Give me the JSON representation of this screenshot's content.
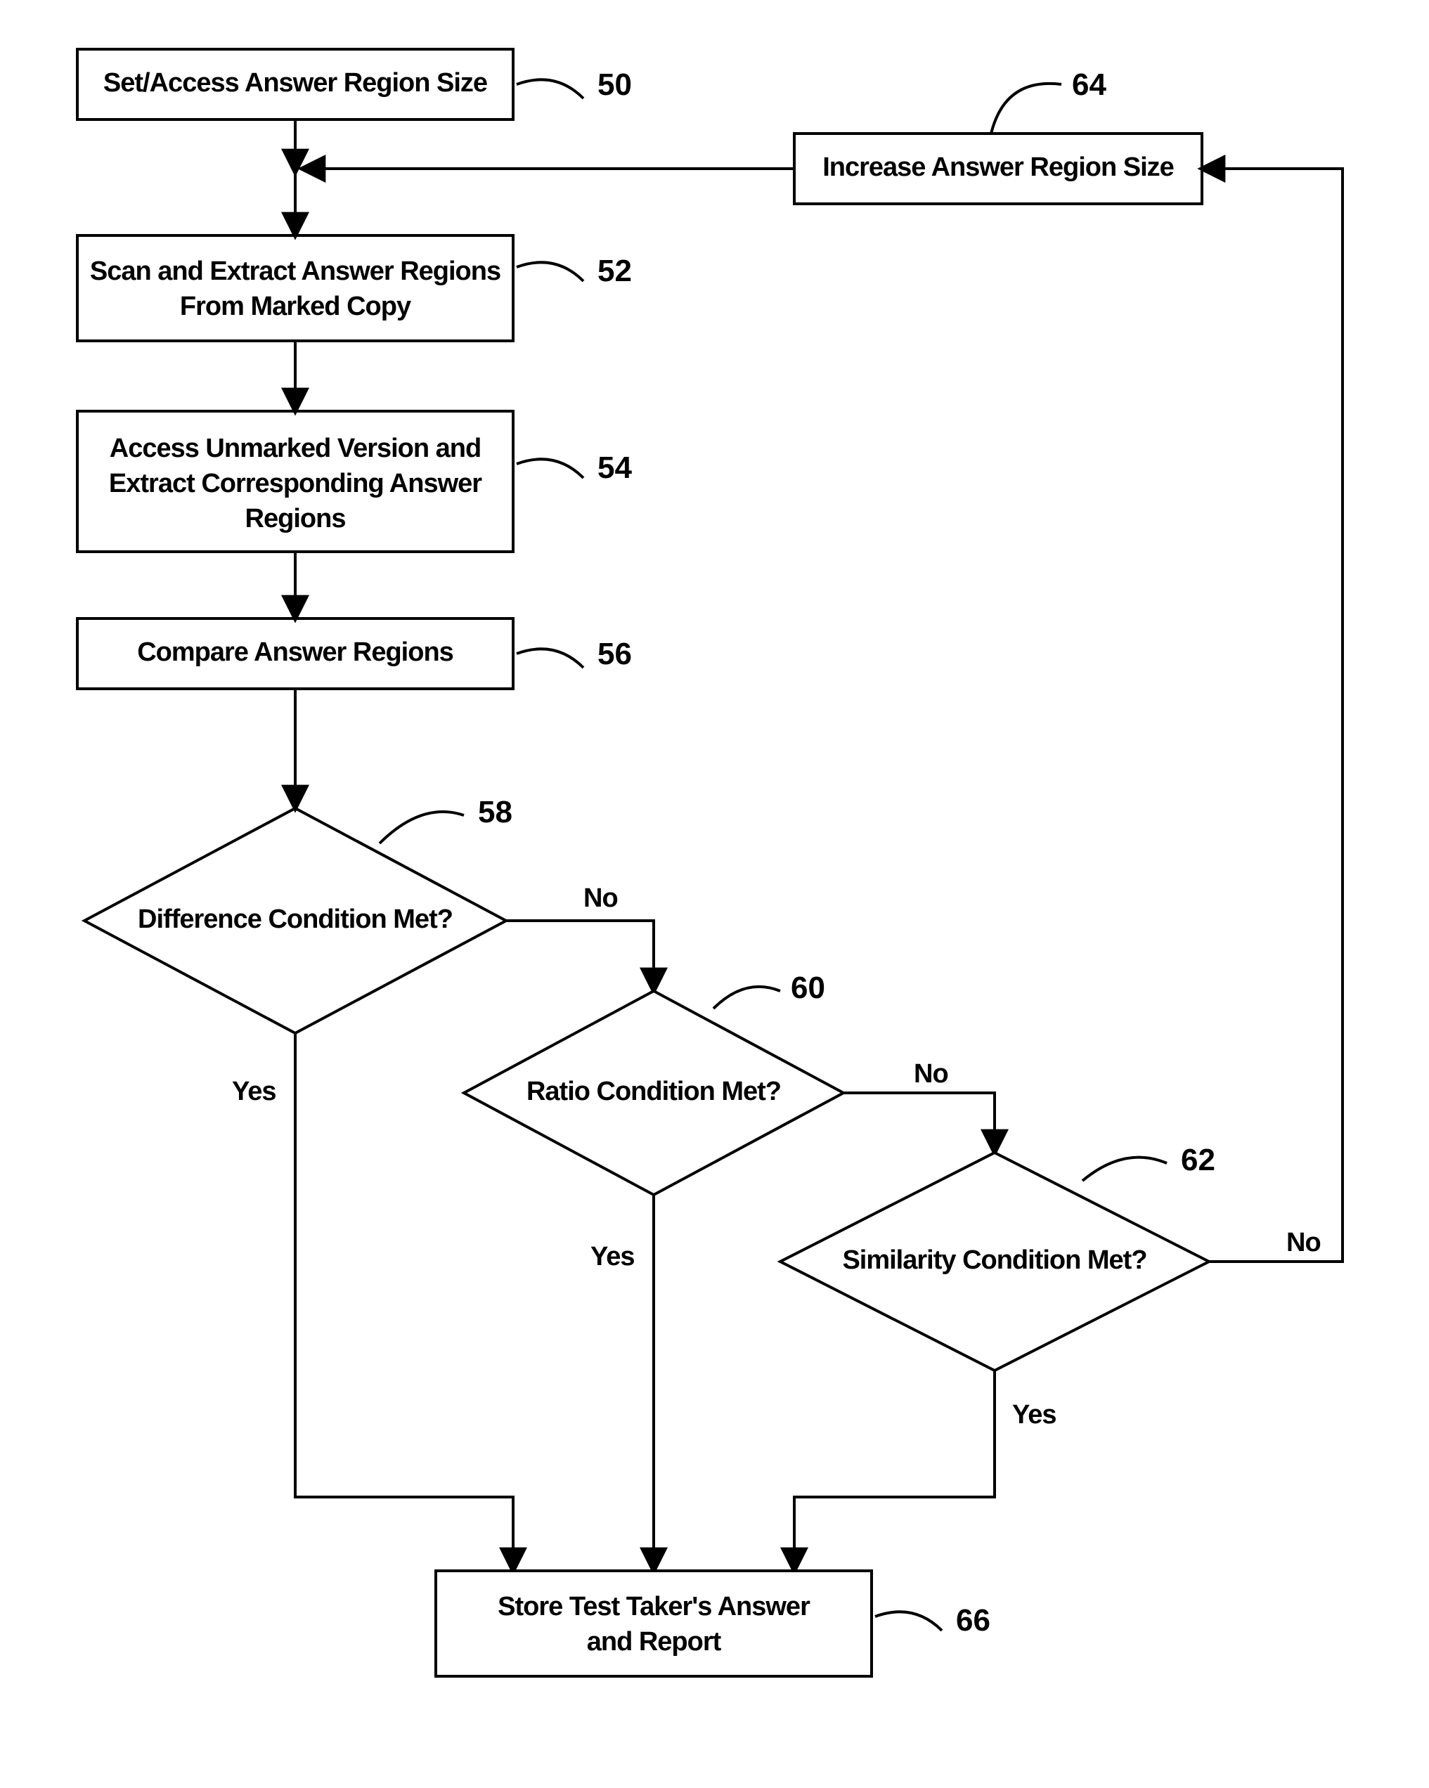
{
  "nodes": {
    "n50": {
      "text": [
        "Set/Access Answer Region Size"
      ],
      "ref": "50"
    },
    "n52": {
      "text": [
        "Scan and Extract Answer Regions",
        "From Marked Copy"
      ],
      "ref": "52"
    },
    "n54": {
      "text": [
        "Access Unmarked Version and",
        "Extract Corresponding Answer",
        "Regions"
      ],
      "ref": "54"
    },
    "n56": {
      "text": [
        "Compare Answer Regions"
      ],
      "ref": "56"
    },
    "n58": {
      "text": [
        "Difference Condition Met?"
      ],
      "ref": "58"
    },
    "n60": {
      "text": [
        "Ratio Condition Met?"
      ],
      "ref": "60"
    },
    "n62": {
      "text": [
        "Similarity Condition Met?"
      ],
      "ref": "62"
    },
    "n64": {
      "text": [
        "Increase Answer Region Size"
      ],
      "ref": "64"
    },
    "n66": {
      "text": [
        "Store Test Taker's Answer",
        "and Report"
      ],
      "ref": "66"
    }
  },
  "labels": {
    "yes": "Yes",
    "no": "No"
  }
}
